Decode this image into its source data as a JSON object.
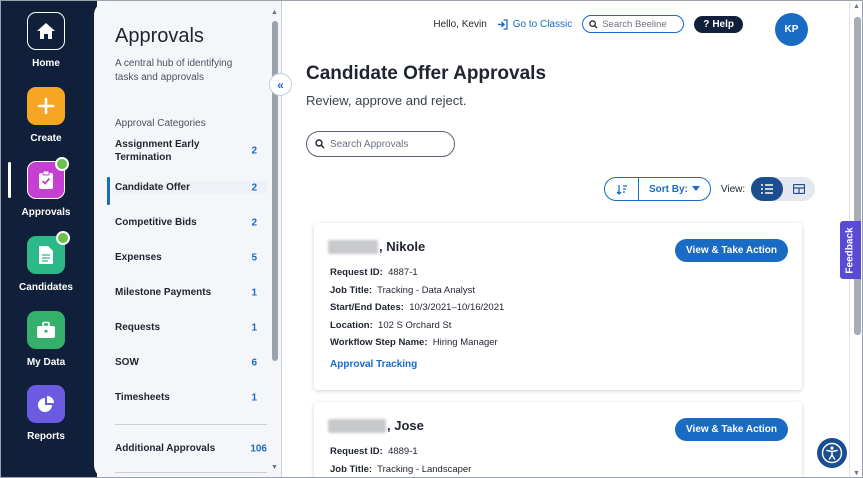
{
  "rail": {
    "items": [
      {
        "label": "Home",
        "icon": "home-icon",
        "color": "#10203a"
      },
      {
        "label": "Create",
        "icon": "plus-icon",
        "color": "#f5a623"
      },
      {
        "label": "Approvals",
        "icon": "clipboard-check-icon",
        "color": "#c53fd1"
      },
      {
        "label": "Candidates",
        "icon": "document-icon",
        "color": "#2fb887"
      },
      {
        "label": "My Data",
        "icon": "briefcase-icon",
        "color": "#34b06b"
      },
      {
        "label": "Reports",
        "icon": "pie-chart-icon",
        "color": "#6a5be0"
      }
    ]
  },
  "side": {
    "title": "Approvals",
    "description": "A central hub of identifying tasks and approvals",
    "categories_heading": "Approval Categories",
    "categories": [
      {
        "label": "Assignment Early Termination",
        "count": "2"
      },
      {
        "label": "Candidate Offer",
        "count": "2"
      },
      {
        "label": "Competitive Bids",
        "count": "2"
      },
      {
        "label": "Expenses",
        "count": "5"
      },
      {
        "label": "Milestone Payments",
        "count": "1"
      },
      {
        "label": "Requests",
        "count": "1"
      },
      {
        "label": "SOW",
        "count": "6"
      },
      {
        "label": "Timesheets",
        "count": "1"
      }
    ],
    "additional": {
      "label": "Additional Approvals",
      "count": "106"
    },
    "collapse_glyph": "«"
  },
  "topbar": {
    "greeting": "Hello, Kevin",
    "classic_link": "Go to Classic",
    "search_placeholder": "Search Beeline",
    "help_label": "Help",
    "avatar_initials": "KP"
  },
  "main": {
    "title": "Candidate Offer Approvals",
    "subtitle": "Review, approve and reject.",
    "search_placeholder": "Search Approvals",
    "sort_label": "Sort By:",
    "view_label": "View:"
  },
  "cards": [
    {
      "name_suffix": ", Nikole",
      "action_label": "View & Take Action",
      "fields": [
        {
          "label": "Request ID:",
          "value": "4887-1"
        },
        {
          "label": "Job Title:",
          "value": "Tracking - Data Analyst"
        },
        {
          "label": "Start/End Dates:",
          "value": "10/3/2021–10/16/2021"
        },
        {
          "label": "Location:",
          "value": "102 S Orchard St"
        },
        {
          "label": "Workflow Step Name:",
          "value": "Hiring Manager"
        }
      ],
      "link_label": "Approval Tracking"
    },
    {
      "name_suffix": ", Jose",
      "action_label": "View & Take Action",
      "fields": [
        {
          "label": "Request ID:",
          "value": "4889-1"
        },
        {
          "label": "Job Title:",
          "value": "Tracking - Landscaper"
        }
      ]
    }
  ],
  "feedback_label": "Feedback",
  "colors": {
    "accent": "#1a6bc4",
    "navy": "#10203a",
    "badge_green": "#6bc24a",
    "feedback": "#5b4ad3"
  }
}
